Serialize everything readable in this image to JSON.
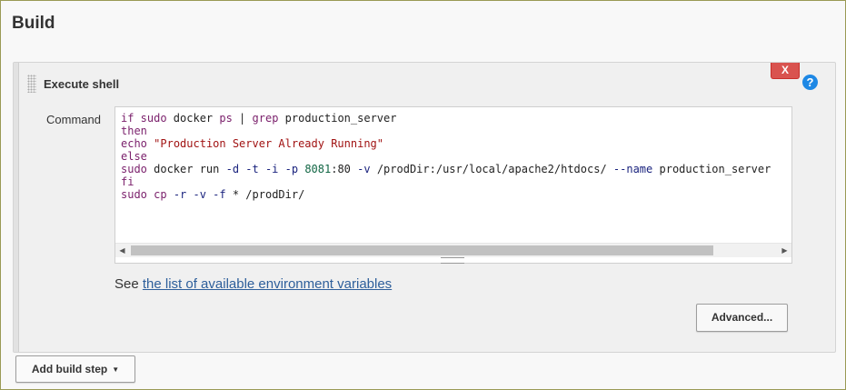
{
  "section": {
    "title": "Build"
  },
  "step": {
    "title": "Execute shell",
    "delete_label": "X",
    "help_label": "?",
    "command_label": "Command",
    "code_lines": [
      [
        {
          "t": "if sudo ",
          "c": "kw"
        },
        {
          "t": "docker ",
          "c": ""
        },
        {
          "t": "ps",
          "c": "kw"
        },
        {
          "t": " | ",
          "c": ""
        },
        {
          "t": "grep",
          "c": "kw"
        },
        {
          "t": " production_server",
          "c": ""
        }
      ],
      [
        {
          "t": "then",
          "c": "kw"
        }
      ],
      [
        {
          "t": "echo",
          "c": "kw"
        },
        {
          "t": " ",
          "c": ""
        },
        {
          "t": "\"Production Server Already Running\"",
          "c": "str"
        }
      ],
      [
        {
          "t": "else",
          "c": "kw"
        }
      ],
      [
        {
          "t": "sudo",
          "c": "kw"
        },
        {
          "t": " docker run ",
          "c": ""
        },
        {
          "t": "-d -t -i -p",
          "c": "op"
        },
        {
          "t": " ",
          "c": ""
        },
        {
          "t": "8081",
          "c": "num"
        },
        {
          "t": ":80 ",
          "c": ""
        },
        {
          "t": "-v",
          "c": "op"
        },
        {
          "t": " /prodDir:/usr/local/apache2/htdocs/ ",
          "c": ""
        },
        {
          "t": "--name",
          "c": "op"
        },
        {
          "t": " production_server",
          "c": ""
        }
      ],
      [
        {
          "t": "fi",
          "c": "kw"
        }
      ],
      [
        {
          "t": "sudo",
          "c": "kw"
        },
        {
          "t": " ",
          "c": ""
        },
        {
          "t": "cp",
          "c": "kw"
        },
        {
          "t": " ",
          "c": ""
        },
        {
          "t": "-r -v -f",
          "c": "op"
        },
        {
          "t": " * /prodDir/",
          "c": ""
        }
      ]
    ],
    "env_prefix": "See ",
    "env_link": "the list of available environment variables",
    "advanced_label": "Advanced..."
  },
  "add_build_step": {
    "label": "Add build step",
    "caret": "▼"
  },
  "icons": {
    "delete": "close-icon",
    "help": "question-circle-icon",
    "grip": "drag-handle-icon"
  },
  "colors": {
    "delete": "#d9534f",
    "help": "#1e88e5",
    "link": "#2e5f9b",
    "keyword": "#7a1f6b",
    "string": "#a11313"
  }
}
